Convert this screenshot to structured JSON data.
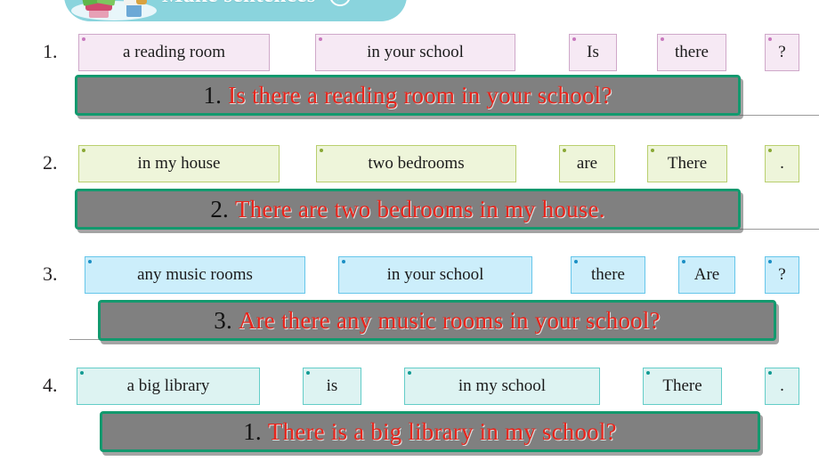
{
  "banner": {
    "title": "Make sentences",
    "play_icon": "play-arrow-icon",
    "bg_color": "#8ad4dd",
    "title_color": "#ffffff"
  },
  "colors": {
    "bar_fill": "#808080",
    "bar_border": "#13996e",
    "answer_red": "#e8251c",
    "tile_pink": "#f6e9f4",
    "tile_green": "#eef5da",
    "tile_blue": "#cceefb",
    "tile_teal": "#ddf3f2"
  },
  "exercises": [
    {
      "number": "1.",
      "palette": "pal-pink",
      "tiles": [
        {
          "text": "a reading room"
        },
        {
          "text": "in your school"
        },
        {
          "text": "Is"
        },
        {
          "text": "there"
        },
        {
          "text": "?"
        }
      ],
      "answer": {
        "index": "1.",
        "sentence": "Is there a reading room in your school?"
      }
    },
    {
      "number": "2.",
      "palette": "pal-green",
      "tiles": [
        {
          "text": "in my house"
        },
        {
          "text": "two bedrooms"
        },
        {
          "text": "are"
        },
        {
          "text": "There"
        },
        {
          "text": "."
        }
      ],
      "answer": {
        "index": "2.",
        "sentence": "There are two bedrooms in my house."
      }
    },
    {
      "number": "3.",
      "palette": "pal-blue",
      "tiles": [
        {
          "text": "any music rooms"
        },
        {
          "text": "in your school"
        },
        {
          "text": "there"
        },
        {
          "text": "Are"
        },
        {
          "text": "?"
        }
      ],
      "answer": {
        "index": "3.",
        "sentence": "Are there any music rooms in your school?"
      }
    },
    {
      "number": "4.",
      "palette": "pal-teal",
      "tiles": [
        {
          "text": "a big library"
        },
        {
          "text": "is"
        },
        {
          "text": "in my school"
        },
        {
          "text": "There"
        },
        {
          "text": "."
        }
      ],
      "answer": {
        "index": "1.",
        "sentence": "There is a big library in my school?"
      }
    }
  ]
}
